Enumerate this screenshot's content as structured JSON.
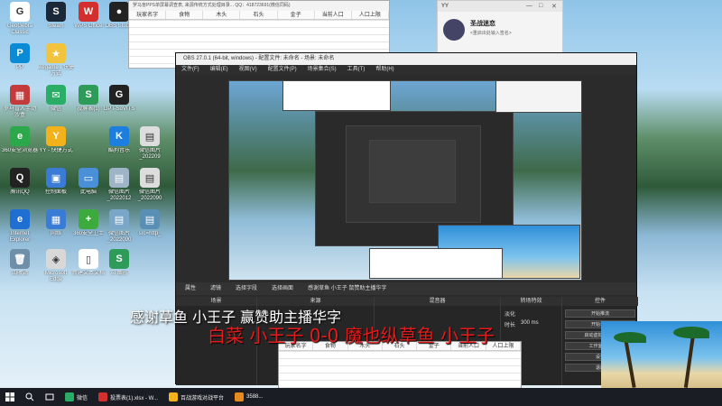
{
  "desktop_icons": [
    {
      "label": "GeoGebra Classic",
      "color": "#ffffff",
      "txt": "G"
    },
    {
      "label": "Steam",
      "color": "#1b2838",
      "txt": "S"
    },
    {
      "label": "WPS Office",
      "color": "#d32f2f",
      "txt": "W"
    },
    {
      "label": "OBS Studio",
      "color": "#222222",
      "txt": "●"
    },
    {
      "label": "PP",
      "color": "#0b8bd6",
      "txt": "P"
    },
    {
      "label": "wegame - 快捷方式",
      "color": "#f2c33d",
      "txt": "★"
    },
    {
      "label": "罗马盲人手动沙盒",
      "color": "#c43b3b",
      "txt": "▦"
    },
    {
      "label": "微信",
      "color": "#2aae67",
      "txt": "✉"
    },
    {
      "label": "投屏表(1)",
      "color": "#2e9c58",
      "txt": "S"
    },
    {
      "label": "GPT-SoVITS",
      "color": "#222222",
      "txt": "G"
    },
    {
      "label": "360安全浏览器",
      "color": "#2aa84a",
      "txt": "e"
    },
    {
      "label": "YY - 快捷方式",
      "color": "#f3b21b",
      "txt": "Y"
    },
    {
      "label": "酷狗音乐",
      "color": "#1c7fe0",
      "txt": "K"
    },
    {
      "label": "微信图片_202209",
      "color": "#dddddd",
      "txt": "▤"
    },
    {
      "label": "腾讯QQ",
      "color": "#222222",
      "txt": "Q"
    },
    {
      "label": "控制面板",
      "color": "#3a7bd5",
      "txt": "▣"
    },
    {
      "label": "此电脑",
      "color": "#4a90d9",
      "txt": "▭"
    },
    {
      "label": "微信图片_2022012",
      "color": "#a0b4c8",
      "txt": "▤"
    },
    {
      "label": "微信图片_2022090",
      "color": "#dddddd",
      "txt": "▤"
    },
    {
      "label": "Internet Explorer",
      "color": "#1e6fd1",
      "txt": "e"
    },
    {
      "label": "网络",
      "color": "#3a7bd5",
      "txt": "▦"
    },
    {
      "label": "360安全卫士",
      "color": "#3daa3d",
      "txt": "+"
    },
    {
      "label": "微信图片_2022090",
      "color": "#7aa7c7",
      "txt": "▤"
    },
    {
      "label": "src=http_",
      "color": "#5a8fb5",
      "txt": "▤"
    },
    {
      "label": "回收站",
      "color": "#6f8fa8",
      "txt": "🗑"
    },
    {
      "label": "Microsoft Edge",
      "color": "#d8d8d8",
      "txt": "◈"
    },
    {
      "label": "新建文本文档",
      "color": "#ffffff",
      "txt": "▯"
    },
    {
      "label": "AI 图形",
      "color": "#2e9c58",
      "txt": "S"
    }
  ],
  "excel_top": {
    "title": "罗马盲PPS单屏幕调查表, 来源传统方式处理目录... QQ：418723691(微信同码)",
    "columns": [
      "玩家名字",
      "食物",
      "木头",
      "石头",
      "金子",
      "当前人口",
      "人口上限"
    ]
  },
  "contact_card": {
    "title": "YY",
    "name": "圣战迷恋",
    "subtitle": "<重启出处输入签名>",
    "controls": [
      "—",
      "□",
      "✕"
    ]
  },
  "obs": {
    "title": "OBS 27.0.1 (64-bit, windows) - 配置文件: 未命名 - 场景: 未命名",
    "menu": [
      "文件(F)",
      "编辑(E)",
      "视图(V)",
      "配置文件(P)",
      "场景集合(S)",
      "工具(T)",
      "帮助(H)"
    ],
    "toolbar": [
      "属性",
      "滤镜",
      "选择字段",
      "选择画面",
      "感谢草鱼 小王子 鼠赞助主播华字"
    ],
    "docks": [
      "场景",
      "来源",
      "混音器",
      "转场特效",
      "控件"
    ],
    "controls": [
      "开始推流",
      "开始录制",
      "启动虚拟摄像机",
      "工作室模式",
      "设置",
      "退出"
    ],
    "fade_label": "淡化",
    "duration_label": "时长",
    "duration_value": "300 ms"
  },
  "overlay": {
    "thanks": "感谢草鱼 小王子 赢赞助主播华字",
    "score": "白菜 小王子 0-0 魔也纵草鱼 小王子"
  },
  "excel_bottom": {
    "columns": [
      "玩家名字",
      "食物",
      "木头",
      "石头",
      "金子",
      "当前人口",
      "人口上限"
    ]
  },
  "taskbar": {
    "items": [
      {
        "label": "微信",
        "color": "#2aae67"
      },
      {
        "label": "投票表(1).xlsx - W...",
        "color": "#d32f2f"
      },
      {
        "label": "百战游戏对战平台",
        "color": "#f3b21b"
      },
      {
        "label": "3588...",
        "color": "#e58a1e"
      }
    ]
  }
}
